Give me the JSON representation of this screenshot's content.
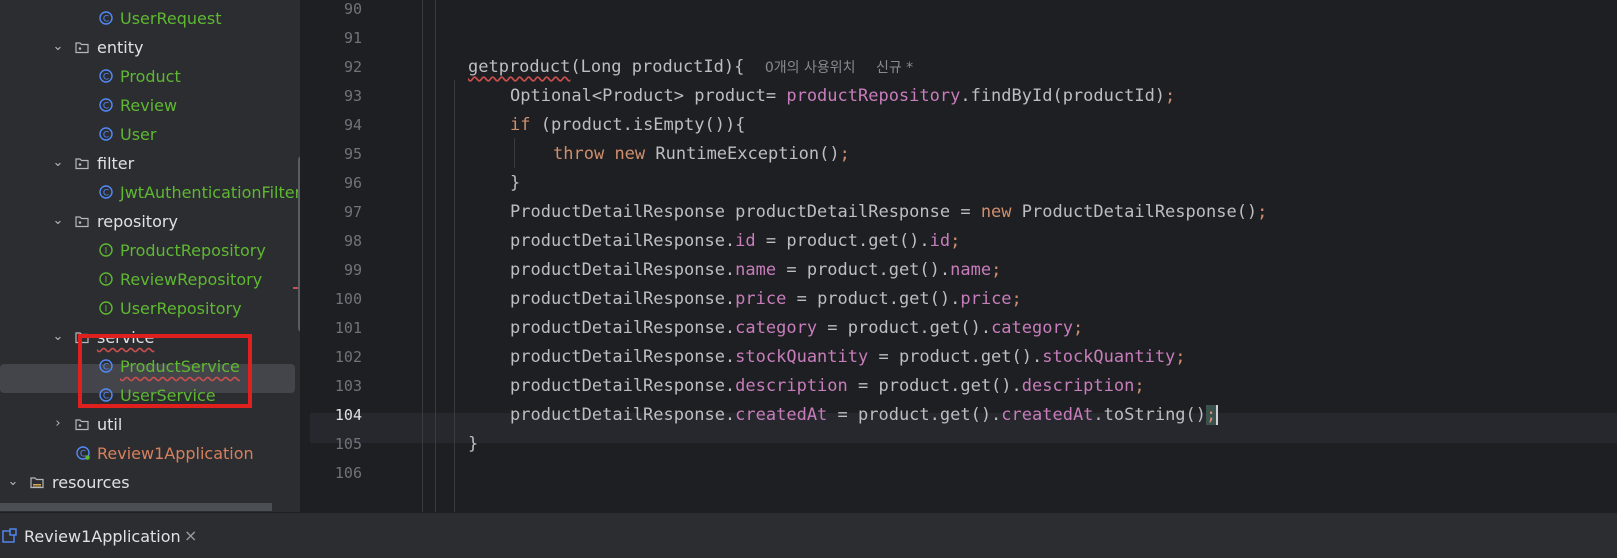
{
  "project_tree": {
    "items": [
      {
        "label": "UserRequest",
        "kind": "class"
      },
      {
        "label": "entity",
        "kind": "package"
      },
      {
        "label": "Product",
        "kind": "class"
      },
      {
        "label": "Review",
        "kind": "class"
      },
      {
        "label": "User",
        "kind": "class"
      },
      {
        "label": "filter",
        "kind": "package"
      },
      {
        "label": "JwtAuthenticationFilter",
        "kind": "class"
      },
      {
        "label": "repository",
        "kind": "package"
      },
      {
        "label": "ProductRepository",
        "kind": "interface"
      },
      {
        "label": "ReviewRepository",
        "kind": "interface"
      },
      {
        "label": "UserRepository",
        "kind": "interface"
      },
      {
        "label": "service",
        "kind": "package"
      },
      {
        "label": "ProductService",
        "kind": "class",
        "selected": true
      },
      {
        "label": "UserService",
        "kind": "class"
      },
      {
        "label": "util",
        "kind": "package"
      },
      {
        "label": "Review1Application",
        "kind": "application"
      },
      {
        "label": "resources",
        "kind": "folder"
      }
    ]
  },
  "editor": {
    "line_numbers": [
      "90",
      "91",
      "92",
      "93",
      "94",
      "95",
      "96",
      "97",
      "98",
      "99",
      "100",
      "101",
      "102",
      "103",
      "104",
      "105",
      "106"
    ],
    "current_line": "104",
    "method_name": "getproduct",
    "method_params": "(Long productId){",
    "usage_hint": "0개의 사용위치",
    "new_hint": "신규 *",
    "lines": {
      "l93a": "Optional<Product> product= ",
      "l93b": "productRepository",
      "l93c": ".findById(productId)",
      "l93d": ";",
      "l94a": "if",
      "l94b": " (product.isEmpty()){",
      "l95a": "throw",
      "l95b": " ",
      "l95c": "new",
      "l95d": " RuntimeException()",
      "l95e": ";",
      "l96": "}",
      "l97a": "ProductDetailResponse productDetailResponse = ",
      "l97b": "new",
      "l97c": " ProductDetailResponse()",
      "l97d": ";",
      "p_obj": "productDetailResponse.",
      "p_eq": " = product.get().",
      "semi": ";",
      "f98": "id",
      "f99": "name",
      "f100": "price",
      "f101": "category",
      "f102": "stockQuantity",
      "f103": "description",
      "f104": "createdAt",
      "l104tail": ".toString()",
      "l105": "}"
    }
  },
  "bottom_tab": {
    "label": "Review1Application",
    "close": "×"
  },
  "colors": {
    "class_name": "#5fb832",
    "keyword": "#cf8e6d",
    "field": "#c77dbb",
    "highlight_box": "#e0201d"
  }
}
